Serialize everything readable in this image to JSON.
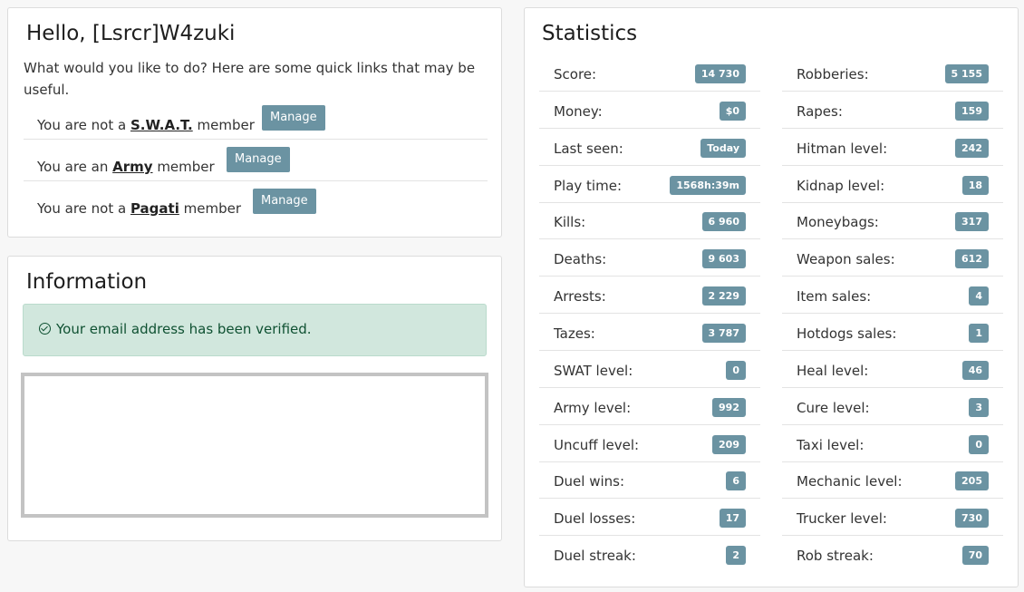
{
  "hello": {
    "title": "Hello, [Lsrcr]W4zuki",
    "intro": "What would you like to do? Here are some quick links that may be useful.",
    "memberships": [
      {
        "prefix": "You are not a ",
        "group": "S.W.A.T.",
        "suffix": " member",
        "button": "Manage"
      },
      {
        "prefix": "You are an ",
        "group": "Army",
        "suffix": " member",
        "button": "Manage"
      },
      {
        "prefix": "You are not a ",
        "group": "Pagati",
        "suffix": " member",
        "button": "Manage"
      }
    ]
  },
  "information": {
    "title": "Information",
    "alert": "Your email address has been verified.",
    "alert_icon": "check-circle-icon"
  },
  "statistics": {
    "title": "Statistics",
    "left": [
      {
        "label": "Score:",
        "value": "14 730"
      },
      {
        "label": "Money:",
        "value": "$0"
      },
      {
        "label": "Last seen:",
        "value": "Today"
      },
      {
        "label": "Play time:",
        "value": "1568h:39m"
      },
      {
        "label": "Kills:",
        "value": "6 960"
      },
      {
        "label": "Deaths:",
        "value": "9 603"
      },
      {
        "label": "Arrests:",
        "value": "2 229"
      },
      {
        "label": "Tazes:",
        "value": "3 787"
      },
      {
        "label": "SWAT level:",
        "value": "0"
      },
      {
        "label": "Army level:",
        "value": "992"
      },
      {
        "label": "Uncuff level:",
        "value": "209"
      },
      {
        "label": "Duel wins:",
        "value": "6"
      },
      {
        "label": "Duel losses:",
        "value": "17"
      },
      {
        "label": "Duel streak:",
        "value": "2"
      }
    ],
    "right": [
      {
        "label": "Robberies:",
        "value": "5 155"
      },
      {
        "label": "Rapes:",
        "value": "159"
      },
      {
        "label": "Hitman level:",
        "value": "242"
      },
      {
        "label": "Kidnap level:",
        "value": "18"
      },
      {
        "label": "Moneybags:",
        "value": "317"
      },
      {
        "label": "Weapon sales:",
        "value": "612"
      },
      {
        "label": "Item sales:",
        "value": "4"
      },
      {
        "label": "Hotdogs sales:",
        "value": "1"
      },
      {
        "label": "Heal level:",
        "value": "46"
      },
      {
        "label": "Cure level:",
        "value": "3"
      },
      {
        "label": "Taxi level:",
        "value": "0"
      },
      {
        "label": "Mechanic level:",
        "value": "205"
      },
      {
        "label": "Trucker level:",
        "value": "730"
      },
      {
        "label": "Rob streak:",
        "value": "70"
      }
    ]
  },
  "colors": {
    "badge": "#6b93a2",
    "alert_bg": "#d1e7dd",
    "alert_text": "#0f5132"
  }
}
